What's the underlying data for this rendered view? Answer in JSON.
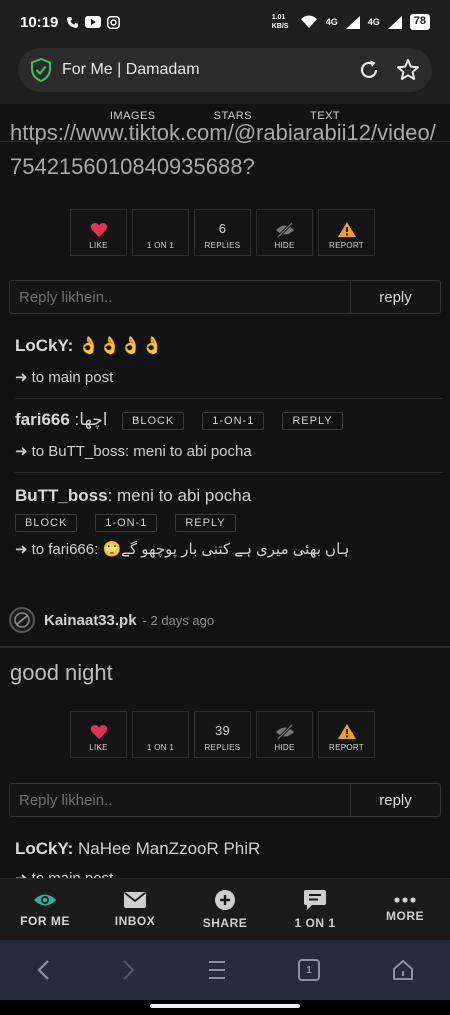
{
  "status": {
    "time": "10:19",
    "net_speed": "1.01 KB/S",
    "net1": "4G",
    "net2": "4G",
    "battery": "78"
  },
  "browser": {
    "title": "For Me | Damadam"
  },
  "top_tabs": [
    "IMAGES",
    "STARS",
    "TEXT"
  ],
  "post1": {
    "text": "https://www.tiktok.com/@rabiarabii12/video/7542156010840935688?",
    "actions": {
      "like": "LIKE",
      "one_on_one": "1 ON 1",
      "replies_count": "6",
      "replies": "REPLIES",
      "hide": "HIDE",
      "report": "REPORT"
    },
    "reply_placeholder": "Reply likhein..",
    "reply_button": "reply",
    "comments": [
      {
        "author": "LoCkY",
        "body": "👌👌👌👌",
        "ref": "to main post"
      },
      {
        "author": "fari666",
        "body": "اچھا",
        "tags": [
          "BLOCK",
          "1-ON-1",
          "REPLY"
        ],
        "ref": "to BuTT_boss: meni to abi pocha"
      },
      {
        "author": "BuTT_boss",
        "body": "meni to abi pocha",
        "tags": [
          "BLOCK",
          "1-ON-1",
          "REPLY"
        ],
        "ref": "to fari666: 🙄ہاں بھئی میری ہے کتنی بار پوچھو گے"
      }
    ]
  },
  "post2_user": {
    "name": "Kainaat33.pk",
    "time": "- 2 days ago"
  },
  "post2": {
    "text": "good night",
    "actions": {
      "like": "LIKE",
      "one_on_one": "1 ON 1",
      "replies_count": "39",
      "replies": "REPLIES",
      "hide": "HIDE",
      "report": "REPORT"
    },
    "reply_placeholder": "Reply likhein..",
    "reply_button": "reply",
    "comment": {
      "author": "LoCkY",
      "body": "NaHee ManZzooR PhiR",
      "ref": "to main post"
    }
  },
  "bottom_nav": [
    "FOR ME",
    "INBOX",
    "SHARE",
    "1 ON 1",
    "MORE"
  ],
  "browser_tab_count": "1",
  "colors": {
    "accent_teal": "#2fb39b",
    "heart": "#e0315b",
    "warning": "#f0a020",
    "shield": "#3ec35a"
  }
}
